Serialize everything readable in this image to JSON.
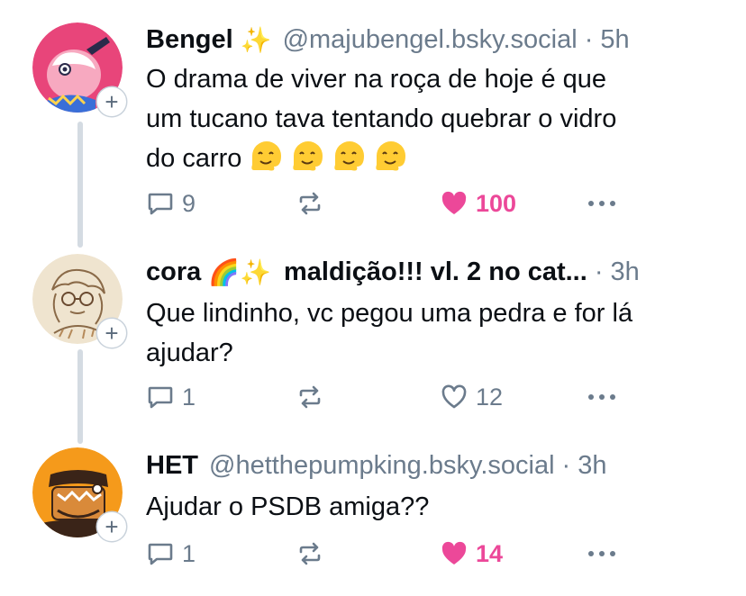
{
  "posts": [
    {
      "display_name": "Bengel",
      "name_emoji": "✨",
      "handle": "@majubengel.bsky.social",
      "separator": "·",
      "time": "5h",
      "text_lines": [
        "O drama de viver na roça de hoje é que",
        "um tucano tava tentando quebrar o vidro",
        "do carro"
      ],
      "trailing_emoji_count": 4,
      "trailing_emoji_name": "melting-face-icon",
      "reply_count": "9",
      "like_count": "100",
      "liked": true,
      "avatar_colors": {
        "bg": "#e8457a",
        "accent": "#7ad0f0"
      }
    },
    {
      "display_name": "cora",
      "name_emoji": "🌈✨",
      "handle": "maldição!!! vl. 2 no cat...",
      "separator": "·",
      "time": "3h",
      "text_lines": [
        "Que lindinho, vc pegou uma pedra e for lá",
        "ajudar?"
      ],
      "reply_count": "1",
      "like_count": "12",
      "liked": false,
      "avatar_colors": {
        "bg": "#efe4cf",
        "accent": "#8a6a48"
      }
    },
    {
      "display_name": "HET",
      "name_emoji": "",
      "handle": "@hetthepumpking.bsky.social",
      "separator": "·",
      "time": "3h",
      "text_lines": [
        "Ajudar o PSDB amiga??"
      ],
      "reply_count": "1",
      "like_count": "14",
      "liked": true,
      "avatar_colors": {
        "bg": "#f59a1b",
        "accent": "#5a3320"
      }
    }
  ],
  "follow_badge": "+",
  "colors": {
    "like": "#ec4899",
    "muted": "#6b7b8c",
    "thread_line": "#d4dbe2"
  }
}
